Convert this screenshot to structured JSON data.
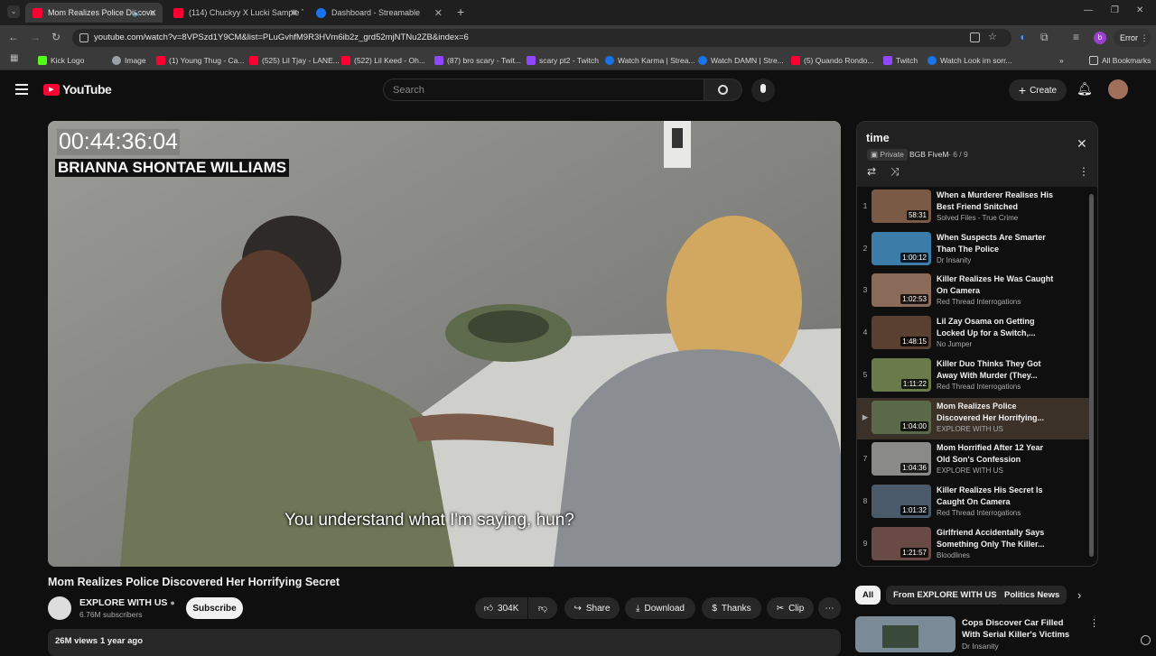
{
  "browser": {
    "tabs": [
      {
        "title": "Mom Realizes Police Discove",
        "color": "#ff0033"
      },
      {
        "title": "(114) Chuckyy X Lucki Sample T",
        "color": "#ff0033"
      },
      {
        "title": "Dashboard - Streamable",
        "color": "#1a73e8"
      }
    ],
    "url": "youtube.com/watch?v=8VPSzd1Y9CM&list=PLuGvhfM9R3HVm6ib2z_grd52mjNTNu2ZB&index=6",
    "profile_letter": "b",
    "error_label": "Error",
    "bookmarks": [
      {
        "label": "Kick Logo",
        "color": "#53fc18"
      },
      {
        "label": "Image",
        "color": "#9aa0a6"
      },
      {
        "label": "(1) Young Thug - Ca...",
        "color": "#ff0033"
      },
      {
        "label": "(525) Lil Tjay - LANE...",
        "color": "#ff0033"
      },
      {
        "label": "(522) Lil Keed - Oh...",
        "color": "#ff0033"
      },
      {
        "label": "(87) bro scary - Twit...",
        "color": "#9146ff"
      },
      {
        "label": "scary pt2 - Twitch",
        "color": "#9146ff"
      },
      {
        "label": "Watch Karma | Strea...",
        "color": "#1a73e8"
      },
      {
        "label": "Watch DAMN | Stre...",
        "color": "#1a73e8"
      },
      {
        "label": "(5) Quando Rondo...",
        "color": "#ff0033"
      },
      {
        "label": "Twitch",
        "color": "#9146ff"
      },
      {
        "label": "Watch Look im sorr...",
        "color": "#1a73e8"
      }
    ],
    "all_bookmarks": "All Bookmarks"
  },
  "yt": {
    "logo_text": "YouTube",
    "search_placeholder": "Search",
    "create_label": "Create"
  },
  "video": {
    "timecode": "00:44:36:04",
    "name_caption": "BRIANNA SHONTAE WILLIAMS",
    "subtitle": "You understand what I'm saying, hun?",
    "title": "Mom Realizes Police Discovered Her Horrifying Secret",
    "channel": "EXPLORE WITH US",
    "subscribers": "6.76M subscribers",
    "subscribe_label": "Subscribe",
    "likes": "304K",
    "share_label": "Share",
    "download_label": "Download",
    "thanks_label": "Thanks",
    "clip_label": "Clip",
    "views": "26M views",
    "age": "1 year ago"
  },
  "playlist": {
    "title": "time",
    "privacy": "Private",
    "owner": "BGB FiveM",
    "position": "6 / 9",
    "items": [
      {
        "num": "1",
        "title": "When a Murderer Realises His Best Friend Snitched",
        "channel": "Solved Files - True Crime",
        "duration": "58:31",
        "thumb": "#7a5a44"
      },
      {
        "num": "2",
        "title": "When Suspects Are Smarter Than The Police",
        "channel": "Dr Insanity",
        "duration": "1:00:12",
        "thumb": "#3c7ca8"
      },
      {
        "num": "3",
        "title": "Killer Realizes He Was Caught On Camera",
        "channel": "Red Thread Interrogations",
        "duration": "1:02:53",
        "thumb": "#8a6a58"
      },
      {
        "num": "4",
        "title": "Lil Zay Osama on Getting Locked Up for a Switch,...",
        "channel": "No Jumper",
        "duration": "1:48:15",
        "thumb": "#5a4030"
      },
      {
        "num": "5",
        "title": "Killer Duo Thinks They Got Away With Murder (They...",
        "channel": "Red Thread Interrogations",
        "duration": "1:11:22",
        "thumb": "#6a7a4a"
      },
      {
        "num": "▶",
        "title": "Mom Realizes Police Discovered Her Horrifying...",
        "channel": "EXPLORE WITH US",
        "duration": "1:04:00",
        "thumb": "#5a6a48"
      },
      {
        "num": "7",
        "title": "Mom Horrified After 12 Year Old Son's Confession",
        "channel": "EXPLORE WITH US",
        "duration": "1:04:36",
        "thumb": "#8a8a88"
      },
      {
        "num": "8",
        "title": "Killer Realizes His Secret Is Caught On Camera",
        "channel": "Red Thread Interrogations",
        "duration": "1:01:32",
        "thumb": "#4a5a6a"
      },
      {
        "num": "9",
        "title": "Girlfriend Accidentally Says Something Only The Killer...",
        "channel": "Bloodlines",
        "duration": "1:21:57",
        "thumb": "#6a4a44"
      }
    ]
  },
  "chips": [
    "All",
    "From EXPLORE WITH US",
    "Politics News"
  ],
  "recommended": {
    "title": "Cops Discover Car Filled With Serial Killer's Victims",
    "channel": "Dr Insanity"
  },
  "colors": {
    "accent": "#ff0033",
    "current_item_bg": "#3c3128"
  }
}
